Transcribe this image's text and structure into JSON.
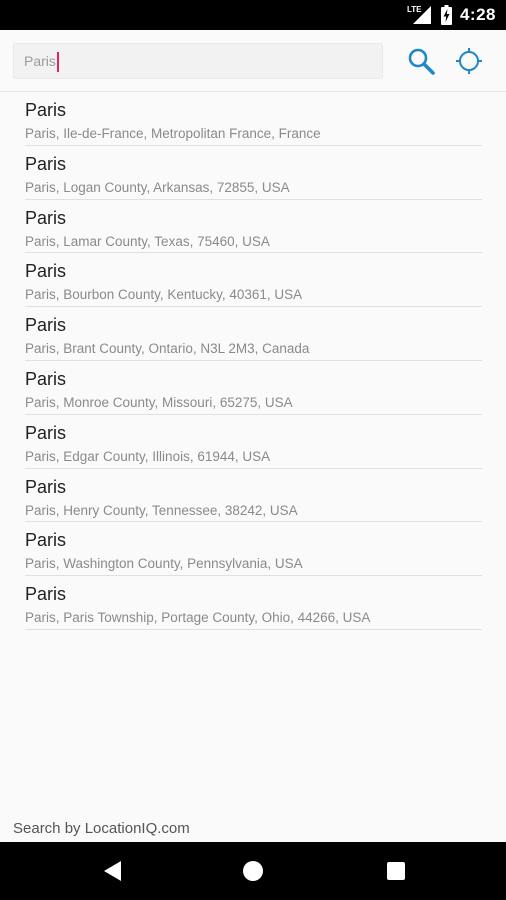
{
  "status_bar": {
    "time": "4:28",
    "network_label": "LTE",
    "icons": [
      "lte-signal-icon",
      "battery-charging-icon"
    ]
  },
  "search": {
    "value": "Paris",
    "icons": [
      "search-icon",
      "my-location-icon"
    ],
    "accent_color": "#1e88c8",
    "cursor_color": "#e91e63"
  },
  "results": [
    {
      "title": "Paris",
      "subtitle": "Paris, Ile-de-France, Metropolitan France, France"
    },
    {
      "title": "Paris",
      "subtitle": "Paris, Logan County, Arkansas, 72855, USA"
    },
    {
      "title": "Paris",
      "subtitle": "Paris, Lamar County, Texas, 75460, USA"
    },
    {
      "title": "Paris",
      "subtitle": "Paris, Bourbon County, Kentucky, 40361, USA"
    },
    {
      "title": "Paris",
      "subtitle": "Paris, Brant County, Ontario, N3L 2M3, Canada"
    },
    {
      "title": "Paris",
      "subtitle": "Paris, Monroe County, Missouri, 65275, USA"
    },
    {
      "title": "Paris",
      "subtitle": "Paris, Edgar County, Illinois, 61944, USA"
    },
    {
      "title": "Paris",
      "subtitle": "Paris, Henry County, Tennessee, 38242, USA"
    },
    {
      "title": "Paris",
      "subtitle": "Paris, Washington County, Pennsylvania, USA"
    },
    {
      "title": "Paris",
      "subtitle": "Paris, Paris Township, Portage County, Ohio, 44266, USA"
    }
  ],
  "footer": {
    "text": "Search by LocationIQ.com"
  },
  "nav_bar": {
    "icons": [
      "back-icon",
      "home-icon",
      "recents-icon"
    ]
  }
}
